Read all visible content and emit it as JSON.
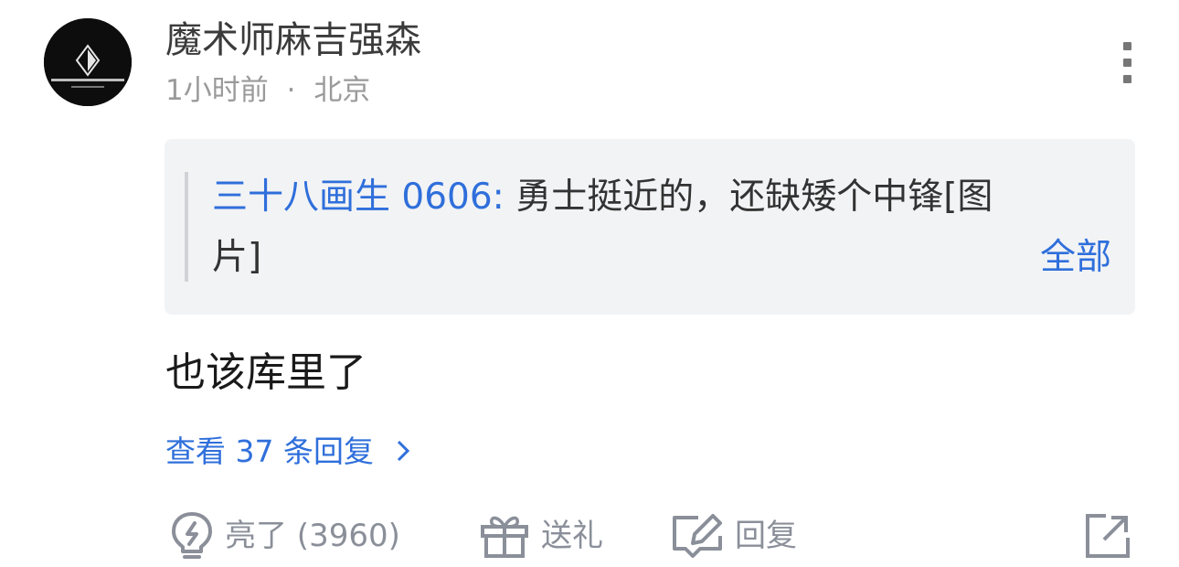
{
  "post": {
    "username": "魔术师麻吉强森",
    "time": "1小时前",
    "separator": "·",
    "location": "北京",
    "avatar_icon": "diamond-logo-avatar"
  },
  "quote": {
    "author": "三十八画生 0606:",
    "text_line1": " 勇士挺近的，还缺矮个中锋[图",
    "text_line2": "片]",
    "expand_label": "全部"
  },
  "comment": {
    "text": "也该库里了"
  },
  "replies": {
    "label": "查看 37 条回复"
  },
  "actions": {
    "like_label": "亮了 (3960)",
    "gift_label": "送礼",
    "reply_label": "回复"
  },
  "colors": {
    "link": "#2f6fdb",
    "secondary_text": "#9a9a9a",
    "icon_gray": "#8a8f99",
    "quote_bg": "#f2f3f5"
  }
}
